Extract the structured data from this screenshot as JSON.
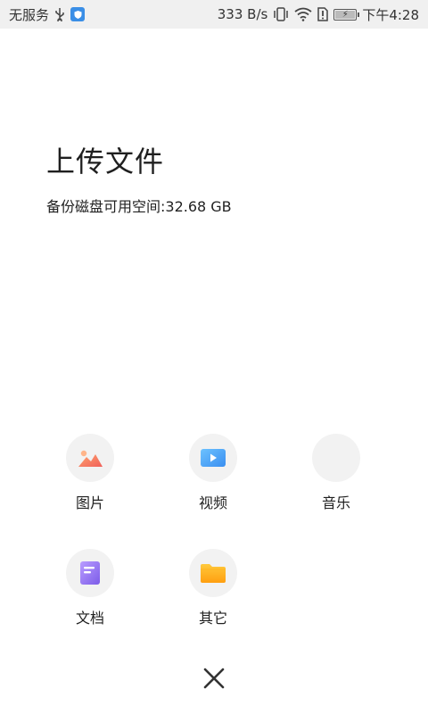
{
  "status_bar": {
    "carrier": "无服务",
    "speed": "333 B/s",
    "time": "下午4:28",
    "icons": [
      "usb-icon",
      "shield-icon",
      "vibrate-icon",
      "wifi-icon",
      "sim-alert-icon",
      "battery-icon"
    ]
  },
  "page": {
    "title": "上传文件",
    "subtitle": "备份磁盘可用空间:32.68 GB"
  },
  "upload_options": [
    {
      "label": "图片",
      "icon": "picture-icon"
    },
    {
      "label": "视频",
      "icon": "video-icon"
    },
    {
      "label": "音乐",
      "icon": "music-icon"
    },
    {
      "label": "文档",
      "icon": "document-icon"
    },
    {
      "label": "其它",
      "icon": "folder-icon"
    }
  ],
  "colors": {
    "picture": "#f47b5b",
    "video": "#4ea8f5",
    "music": "#c86de0",
    "document": "#9a7cf0",
    "folder": "#ffb21f"
  }
}
